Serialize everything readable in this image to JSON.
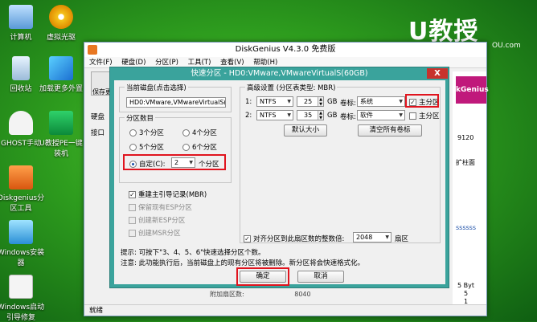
{
  "desktop": {
    "icons": [
      {
        "label": "计算机"
      },
      {
        "label": "虚拟光驱"
      },
      {
        "label": "回收站"
      },
      {
        "label": "加载更多外置"
      },
      {
        "label": "GHOST手动"
      },
      {
        "label": "U教授PE一键装机"
      },
      {
        "label": "Diskgenius分区工具"
      },
      {
        "label": "Windows安装器"
      },
      {
        "label": "Windows启动引导修复"
      }
    ],
    "logo": "U教授",
    "logo_sub": "OU.com"
  },
  "app": {
    "title": "DiskGenius V4.3.0 免费版",
    "menu": [
      "文件(F)",
      "硬盘(D)",
      "分区(P)",
      "工具(T)",
      "查看(V)",
      "帮助(H)"
    ],
    "toolbar_save": "保存更",
    "side_labels": [
      "硬盘",
      "接口"
    ],
    "status": "就绪",
    "right_texts": [
      "9120",
      "扩柱面",
      "ssssss",
      "5 Byt",
      "5",
      "1"
    ],
    "bottom_row_label": "附加扇区数:",
    "bottom_row_value": "8040",
    "banner": "kGenius"
  },
  "dialog": {
    "title": "快速分区 - HD0:VMware,VMwareVirtualS(60GB)",
    "disk_group": "当前磁盘(点击选择)",
    "disk_value": "HD0:VMware,VMwareVirtualS(6",
    "count_group": "分区数目",
    "radios": [
      "3个分区",
      "4个分区",
      "5个分区",
      "6个分区"
    ],
    "custom_label": "自定(C):",
    "custom_value": "2",
    "custom_unit": "个分区",
    "mbr_checks": [
      {
        "label": "重建主引导记录(MBR)",
        "checked": true,
        "disabled": false
      },
      {
        "label": "保留现有ESP分区",
        "checked": false,
        "disabled": true
      },
      {
        "label": "创建新ESP分区",
        "checked": false,
        "disabled": true
      },
      {
        "label": "创建MSR分区",
        "checked": false,
        "disabled": true
      }
    ],
    "adv_group": "高级设置 (分区表类型: MBR)",
    "partitions": [
      {
        "num": "1:",
        "fs": "NTFS",
        "size": "25",
        "unit": "GB",
        "vol_label": "卷标:",
        "vol": "系统",
        "primary_label": "主分区",
        "primary_checked": true
      },
      {
        "num": "2:",
        "fs": "NTFS",
        "size": "35",
        "unit": "GB",
        "vol_label": "卷标:",
        "vol": "软件",
        "primary_label": "主分区",
        "primary_checked": false
      }
    ],
    "default_size_btn": "默认大小",
    "clear_labels_btn": "清空所有卷标",
    "align_label": "对齐分区到此扇区数的整数倍:",
    "align_value": "2048",
    "align_unit": "扇区",
    "tip1": "提示: 可按下\"3、4、5、6\"快速选择分区个数。",
    "tip2": "注意: 此功能执行后，当前磁盘上的现有分区将被删除。新分区将会快速格式化。",
    "ok_btn": "确定",
    "cancel_btn": "取消",
    "close_btn": "X"
  }
}
